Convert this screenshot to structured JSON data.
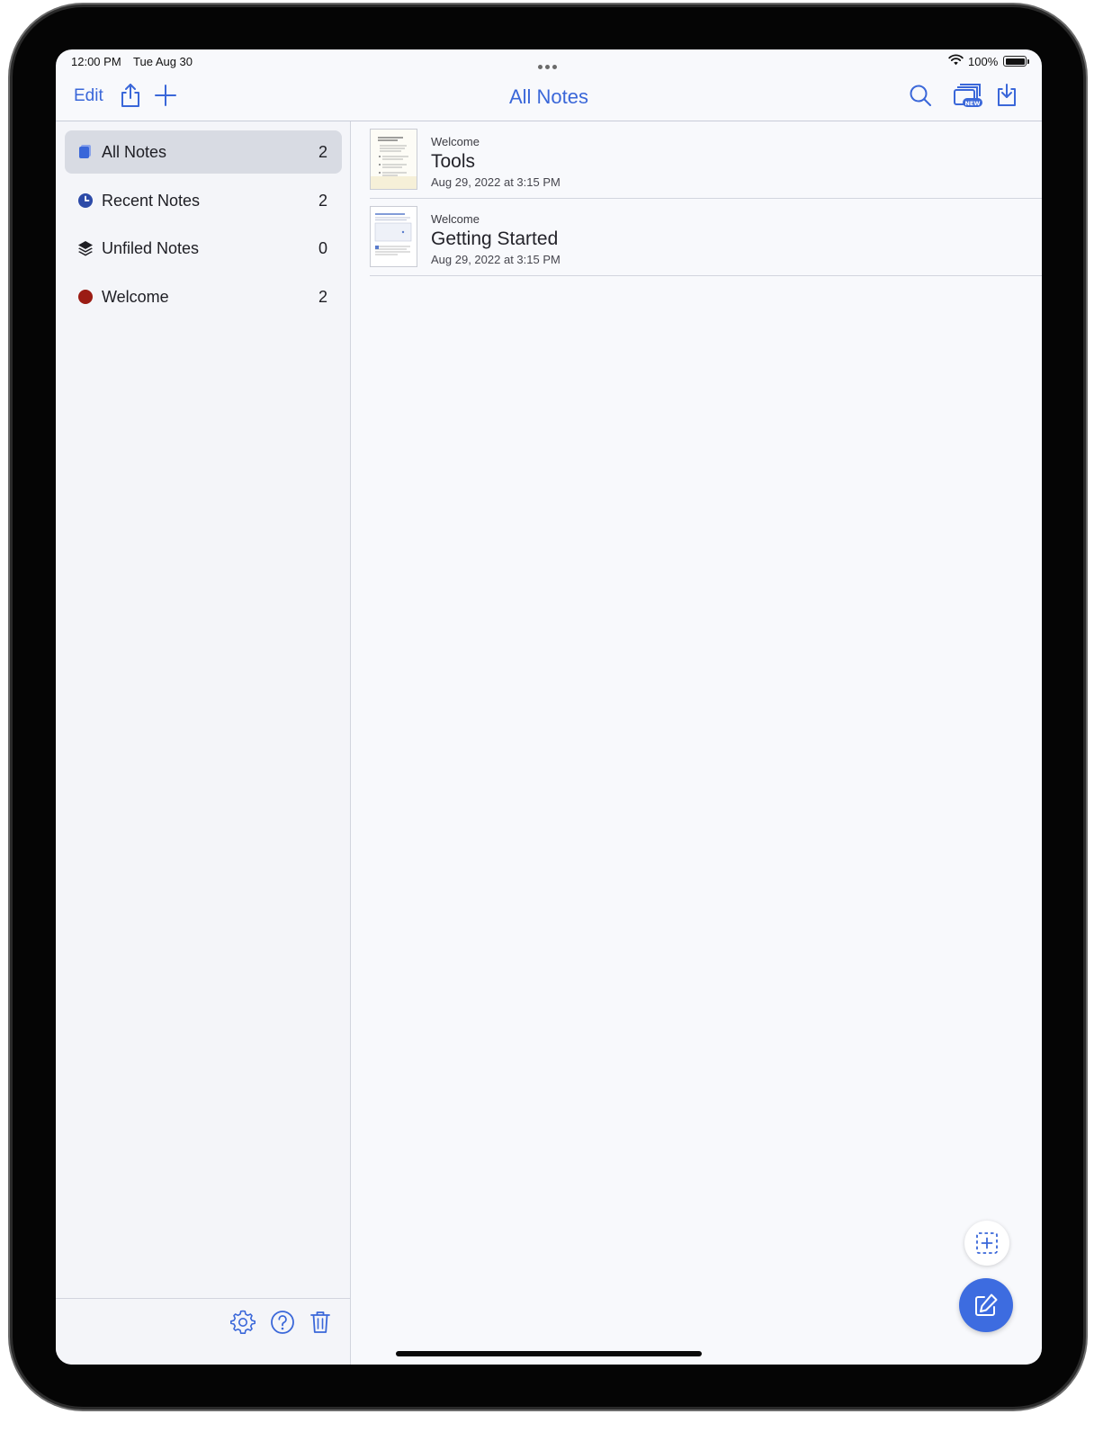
{
  "status_bar": {
    "time": "12:00 PM",
    "date": "Tue Aug 30",
    "battery": "100%"
  },
  "navbar": {
    "edit_label": "Edit",
    "title": "All Notes",
    "new_badge": "NEW"
  },
  "sidebar": {
    "items": [
      {
        "label": "All Notes",
        "count": "2",
        "icon": "notes-stack-icon",
        "selected": true
      },
      {
        "label": "Recent Notes",
        "count": "2",
        "icon": "clock-icon",
        "selected": false
      },
      {
        "label": "Unfiled Notes",
        "count": "0",
        "icon": "layers-icon",
        "selected": false
      },
      {
        "label": "Welcome",
        "count": "2",
        "icon": "folder-dot-icon",
        "selected": false
      }
    ]
  },
  "notes": [
    {
      "folder": "Welcome",
      "title": "Tools",
      "datetime": "Aug 29, 2022 at 3:15 PM"
    },
    {
      "folder": "Welcome",
      "title": "Getting Started",
      "datetime": "Aug 29, 2022 at 3:15 PM"
    }
  ],
  "colors": {
    "accent": "#3a67d9",
    "fab": "#3d6ce0",
    "welcome_dot": "#9b1c14",
    "selected_row": "#d8dbe3"
  }
}
